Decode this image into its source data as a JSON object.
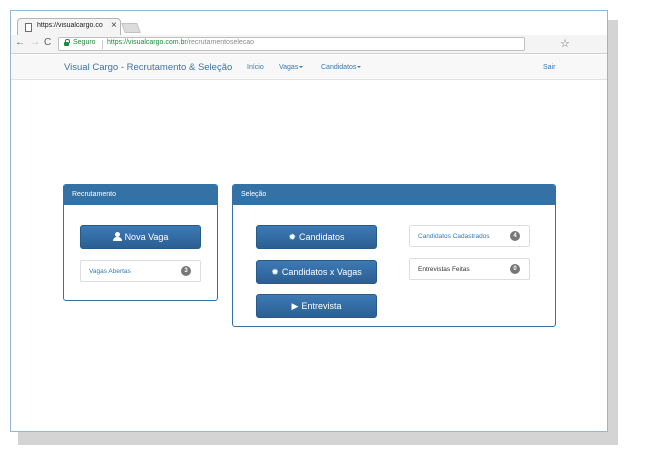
{
  "browser": {
    "tab": {
      "title": "https://visualcargo.com.b",
      "close": "×"
    },
    "nav": {
      "back": "←",
      "forward": "→",
      "reload": "C"
    },
    "address": {
      "secure_label": "Seguro",
      "scheme": "https://",
      "host": "visualcargo.com.br",
      "path": "/recrutamentoselecao"
    },
    "star": "☆"
  },
  "navbar": {
    "brand": "Visual Cargo - Recrutamento & Seleção",
    "links": {
      "inicio": "Início",
      "vagas": "Vagas",
      "candidatos": "Candidatos",
      "sair": "Sair"
    }
  },
  "panels": {
    "recrutamento": {
      "title": "Recrutamento",
      "button_nova_vaga": "Nova Vaga",
      "vagas_abertas": {
        "label": "Vagas Abertas",
        "count": "3"
      }
    },
    "selecao": {
      "title": "Seleção",
      "button_candidatos": "Candidatos",
      "button_candidatos_vagas": "Candidatos x Vagas",
      "button_entrevista": "Entrevista",
      "candidatos_cadastrados": {
        "label": "Candidatos Cadastrados",
        "count": "4"
      },
      "entrevistas_feitas": {
        "label": "Entrevistas Feitas",
        "count": "0"
      }
    }
  },
  "colors": {
    "primary": "#3471a5",
    "link": "#337ab7",
    "badge": "#777777",
    "secure": "#1a8c3e"
  },
  "icons": {
    "nova_vaga": "user-icon",
    "candidatos": "certificate-icon",
    "candidatos_vagas": "certificate-icon",
    "entrevista": "play-icon"
  }
}
